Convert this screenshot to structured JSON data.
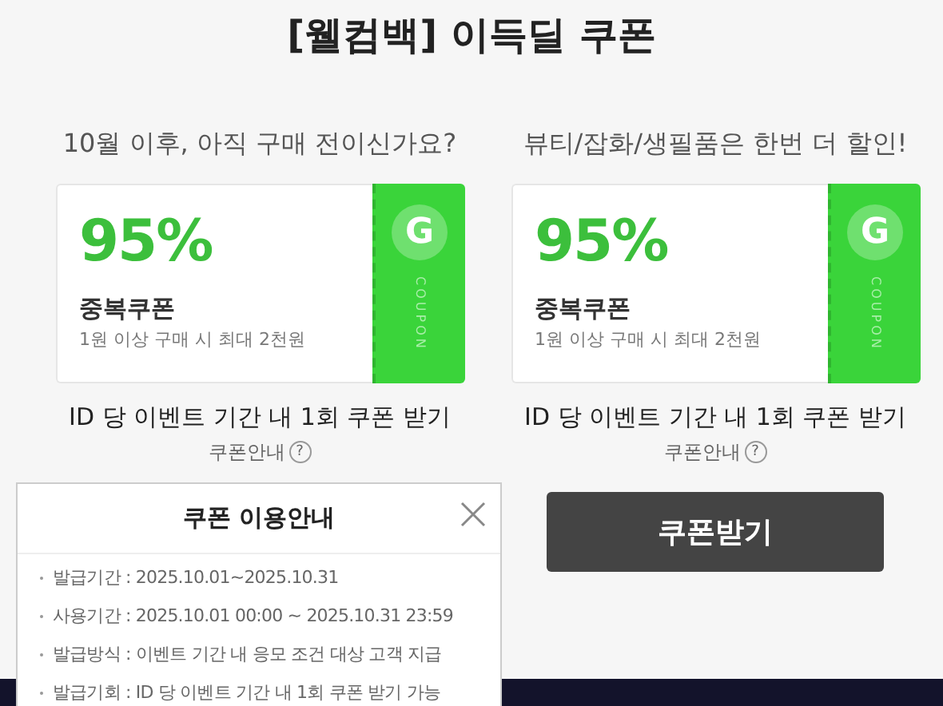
{
  "title": "[웰컴백] 이득딜 쿠폰",
  "columns": [
    {
      "subtitle": "10월 이후, 아직 구매 전이신가요?",
      "coupon": {
        "percent": "95%",
        "name": "중복쿠폰",
        "condition": "1원 이상 구매 시 최대 2천원",
        "logo_letter": "G",
        "stamp": "COUPON"
      },
      "caption": "ID 당 이벤트 기간 내 1회 쿠폰 받기",
      "guide_link": "쿠폰안내",
      "guide_icon": "?"
    },
    {
      "subtitle": "뷰티/잡화/생필품은 한번 더 할인!",
      "coupon": {
        "percent": "95%",
        "name": "중복쿠폰",
        "condition": "1원 이상 구매 시 최대 2천원",
        "logo_letter": "G",
        "stamp": "COUPON"
      },
      "caption": "ID 당 이벤트 기간 내 1회 쿠폰 받기",
      "guide_link": "쿠폰안내",
      "guide_icon": "?",
      "button": "쿠폰받기"
    }
  ],
  "popup": {
    "title": "쿠폰 이용안내",
    "items": [
      "발급기간 : 2025.10.01~2025.10.31",
      "사용기간 : 2025.10.01 00:00 ~ 2025.10.31 23:59",
      "발급방식 : 이벤트 기간 내 응모 조건 대상 고객 지급",
      "발급기회 : ID 당 이벤트 기간 내 1회 쿠폰 받기 가능"
    ]
  }
}
